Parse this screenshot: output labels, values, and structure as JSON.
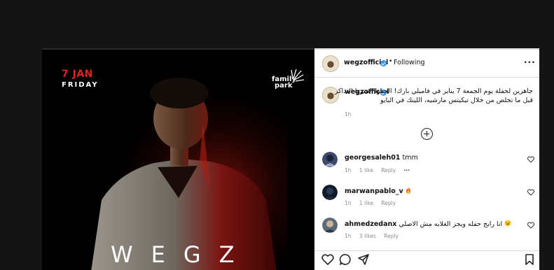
{
  "poster": {
    "date": "7 JAN",
    "day": "FRIDAY",
    "logo_text_line1": "family",
    "logo_text_line2": "park",
    "artist": "WEGZ"
  },
  "post": {
    "username": "wegzofficial",
    "separator": "•",
    "follow_status": "Following",
    "more": "···",
    "caption": "جاهزين لحفلة يوم الجمعة 7 يناير في فاميلي بارك! الحقوا اشتروا التذاكر قبل ما تخلص من خلال تيكيتس مارشيه، اللينك في البايو",
    "caption_time": "1h"
  },
  "comments": [
    {
      "username": "georgesaleh01",
      "text": "tmm",
      "time": "1h",
      "likes": "1 like",
      "reply": "Reply",
      "more": "···",
      "emoji": ""
    },
    {
      "username": "marwanpablo_v",
      "text": "",
      "time": "1h",
      "likes": "1 like",
      "reply": "Reply",
      "more": "",
      "emoji": "fire-emoji"
    },
    {
      "username": "ahmedzedanx",
      "text": "انا رايح حفله ويجز الغلابه مش الاصلي",
      "time": "1h",
      "likes": "3 likes",
      "reply": "Reply",
      "more": "",
      "emoji": "laughing-emoji"
    }
  ],
  "colors": {
    "background": "#141414",
    "panel": "#ffffff",
    "accent_red": "#d8261e",
    "verified_blue": "#3897f0",
    "muted_text": "#8e8e8e"
  },
  "icons": [
    "like-icon",
    "comment-icon",
    "share-icon",
    "save-icon",
    "add-comment-icon",
    "verified-icon",
    "more-icon",
    "heart-icon"
  ]
}
